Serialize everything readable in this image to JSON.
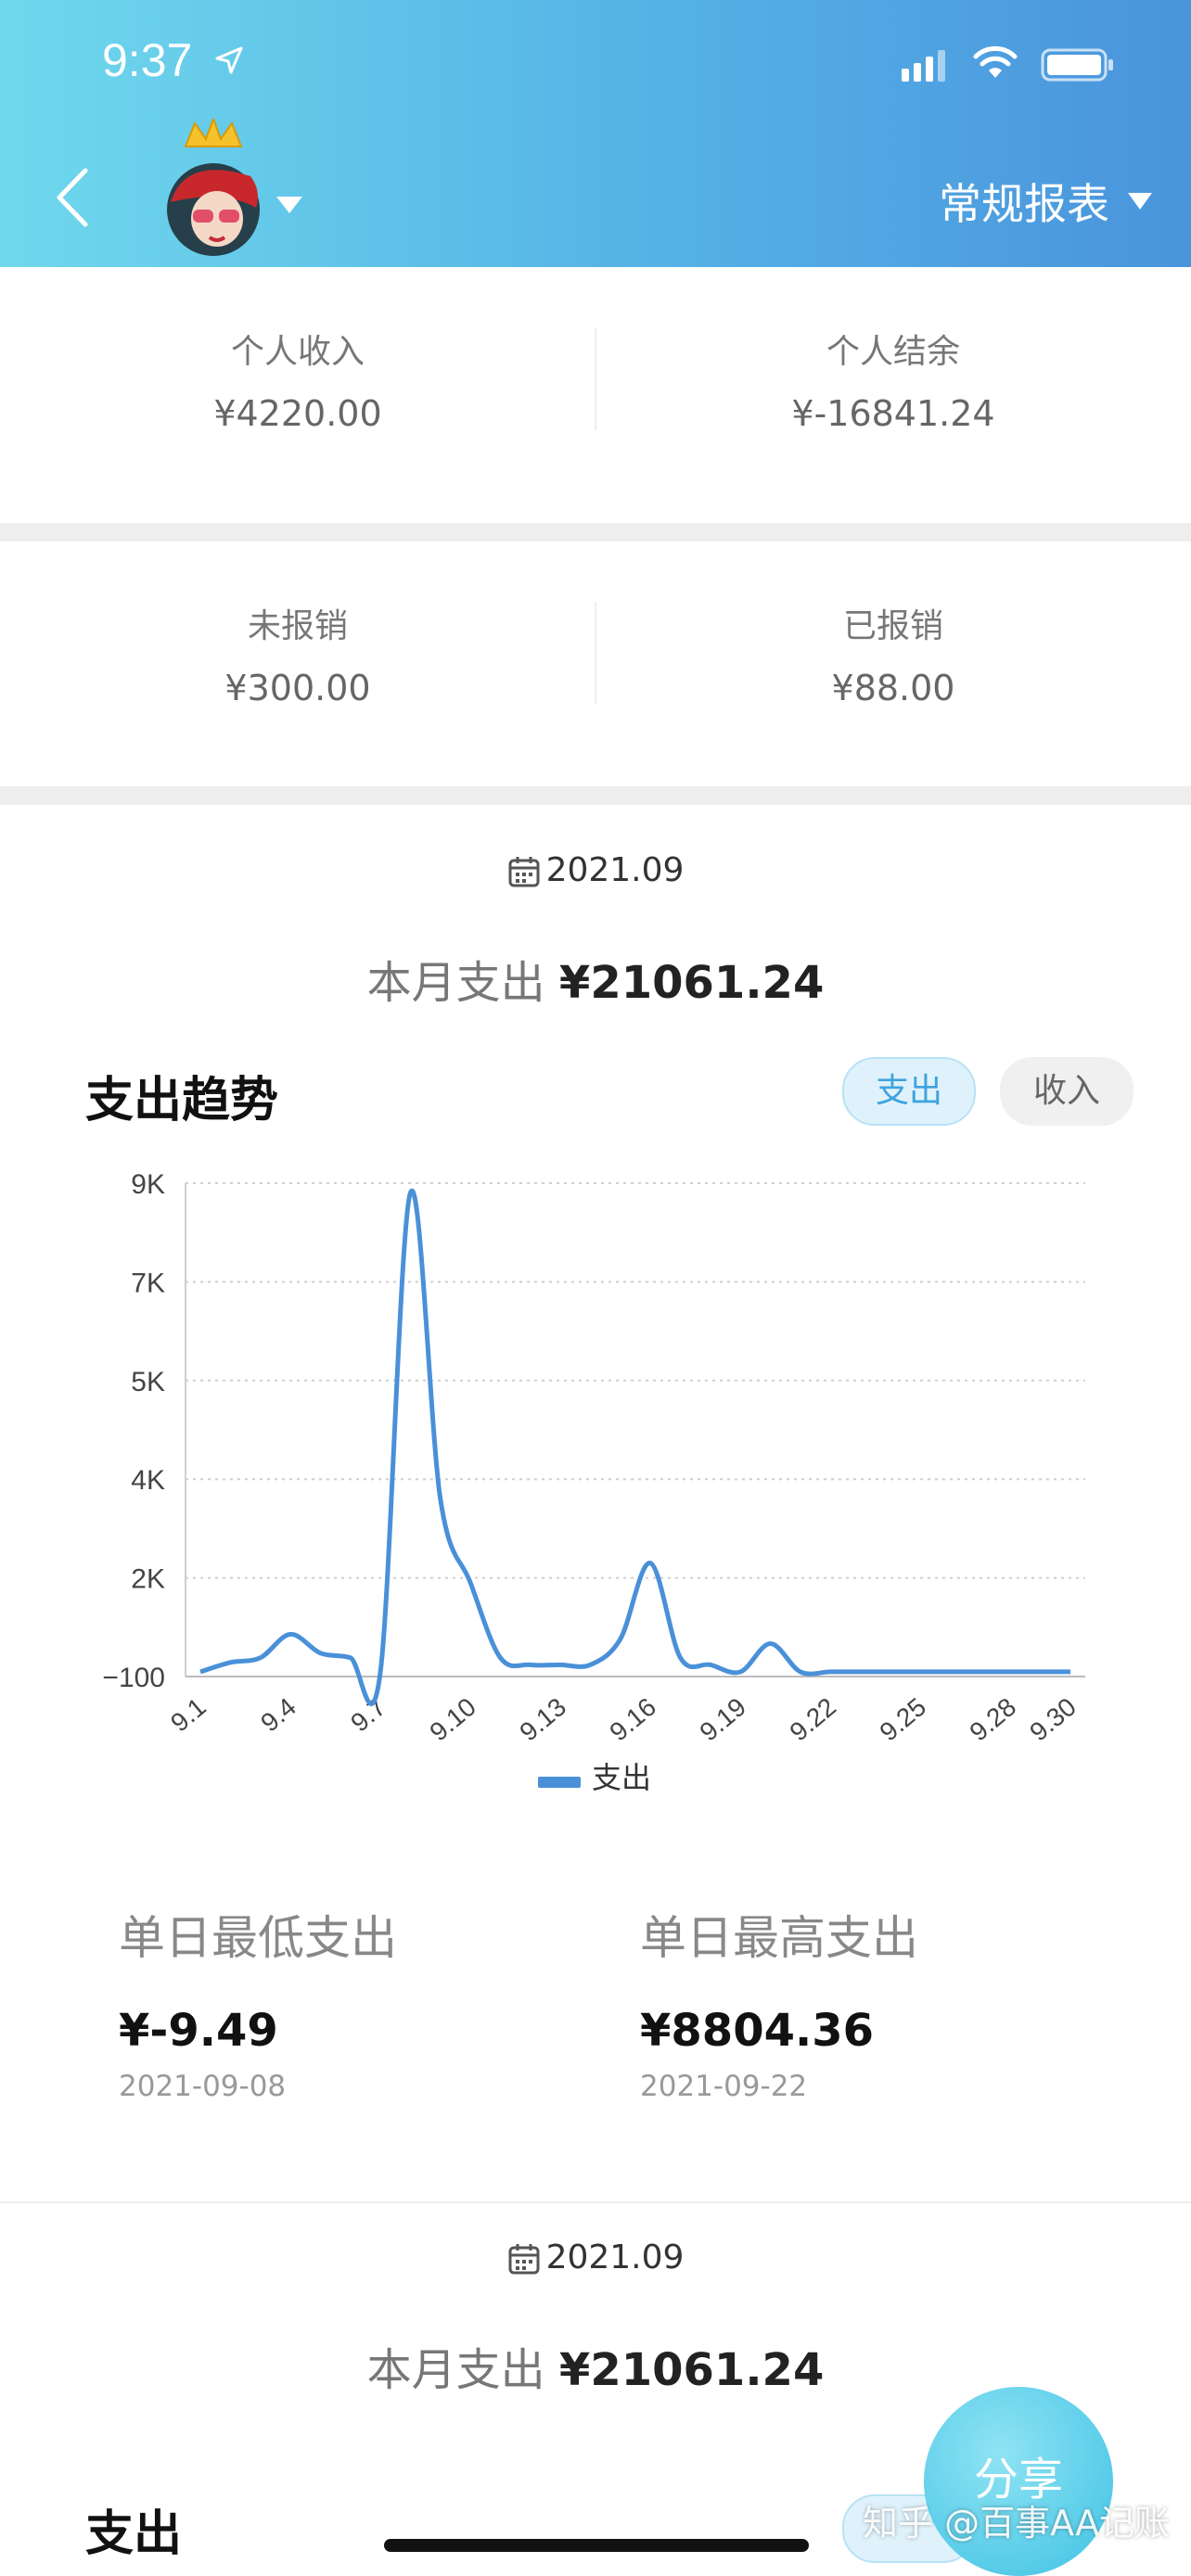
{
  "status_bar": {
    "time": "9:37"
  },
  "header": {
    "report_label": "常规报表"
  },
  "summary": {
    "personal_income_label": "个人收入",
    "personal_income_value": "¥4220.00",
    "personal_balance_label": "个人结余",
    "personal_balance_value": "¥-16841.24",
    "unreimbursed_label": "未报销",
    "unreimbursed_value": "¥300.00",
    "reimbursed_label": "已报销",
    "reimbursed_value": "¥88.00"
  },
  "month_block": {
    "date": "2021.09",
    "total_label": "本月支出",
    "total_value": "¥21061.24"
  },
  "trend": {
    "title": "支出趋势",
    "toggle_expense": "支出",
    "toggle_income": "收入"
  },
  "stats": {
    "min_label": "单日最低支出",
    "min_value": "¥-9.49",
    "min_date": "2021-09-08",
    "max_label": "单日最高支出",
    "max_value": "¥8804.36",
    "max_date": "2021-09-22"
  },
  "month_block_2": {
    "date": "2021.09",
    "total_label": "本月支出",
    "total_value": "¥21061.24"
  },
  "bottom": {
    "section_title": "支出",
    "share_label": "分享",
    "watermark": "知乎 @百事AA记账"
  },
  "colors": {
    "accent": "#4a90d9",
    "header_start": "#6fd8ec",
    "header_end": "#4a94dc"
  },
  "chart_data": {
    "type": "line",
    "x": [
      "9.1",
      "9.2",
      "9.3",
      "9.4",
      "9.5",
      "9.6",
      "9.7",
      "9.8",
      "9.9",
      "9.10",
      "9.11",
      "9.12",
      "9.13",
      "9.14",
      "9.15",
      "9.16",
      "9.17",
      "9.18",
      "9.19",
      "9.20",
      "9.21",
      "9.22",
      "9.23",
      "9.24",
      "9.25",
      "9.26",
      "9.27",
      "9.28",
      "9.29",
      "9.30"
    ],
    "x_tick_labels": [
      "9.1",
      "9.4",
      "9.7",
      "9.10",
      "9.13",
      "9.16",
      "9.19",
      "9.22",
      "9.25",
      "9.28",
      "9.30"
    ],
    "y_tick_labels": [
      "9K",
      "7K",
      "5K",
      "4K",
      "2K",
      "−100"
    ],
    "y_tick_values": [
      9000,
      7000,
      5000,
      4000,
      2000,
      -100
    ],
    "series": [
      {
        "name": "支出",
        "color": "#4a90d9",
        "values": [
          0,
          200,
          300,
          800,
          400,
          300,
          -9.49,
          8804.36,
          3600,
          1900,
          300,
          150,
          150,
          150,
          700,
          2300,
          300,
          150,
          0,
          600,
          0,
          0,
          0,
          0,
          0,
          0,
          0,
          0,
          0,
          0
        ]
      }
    ],
    "ylim": [
      -100,
      9000
    ],
    "grid": true,
    "legend": "bottom"
  }
}
